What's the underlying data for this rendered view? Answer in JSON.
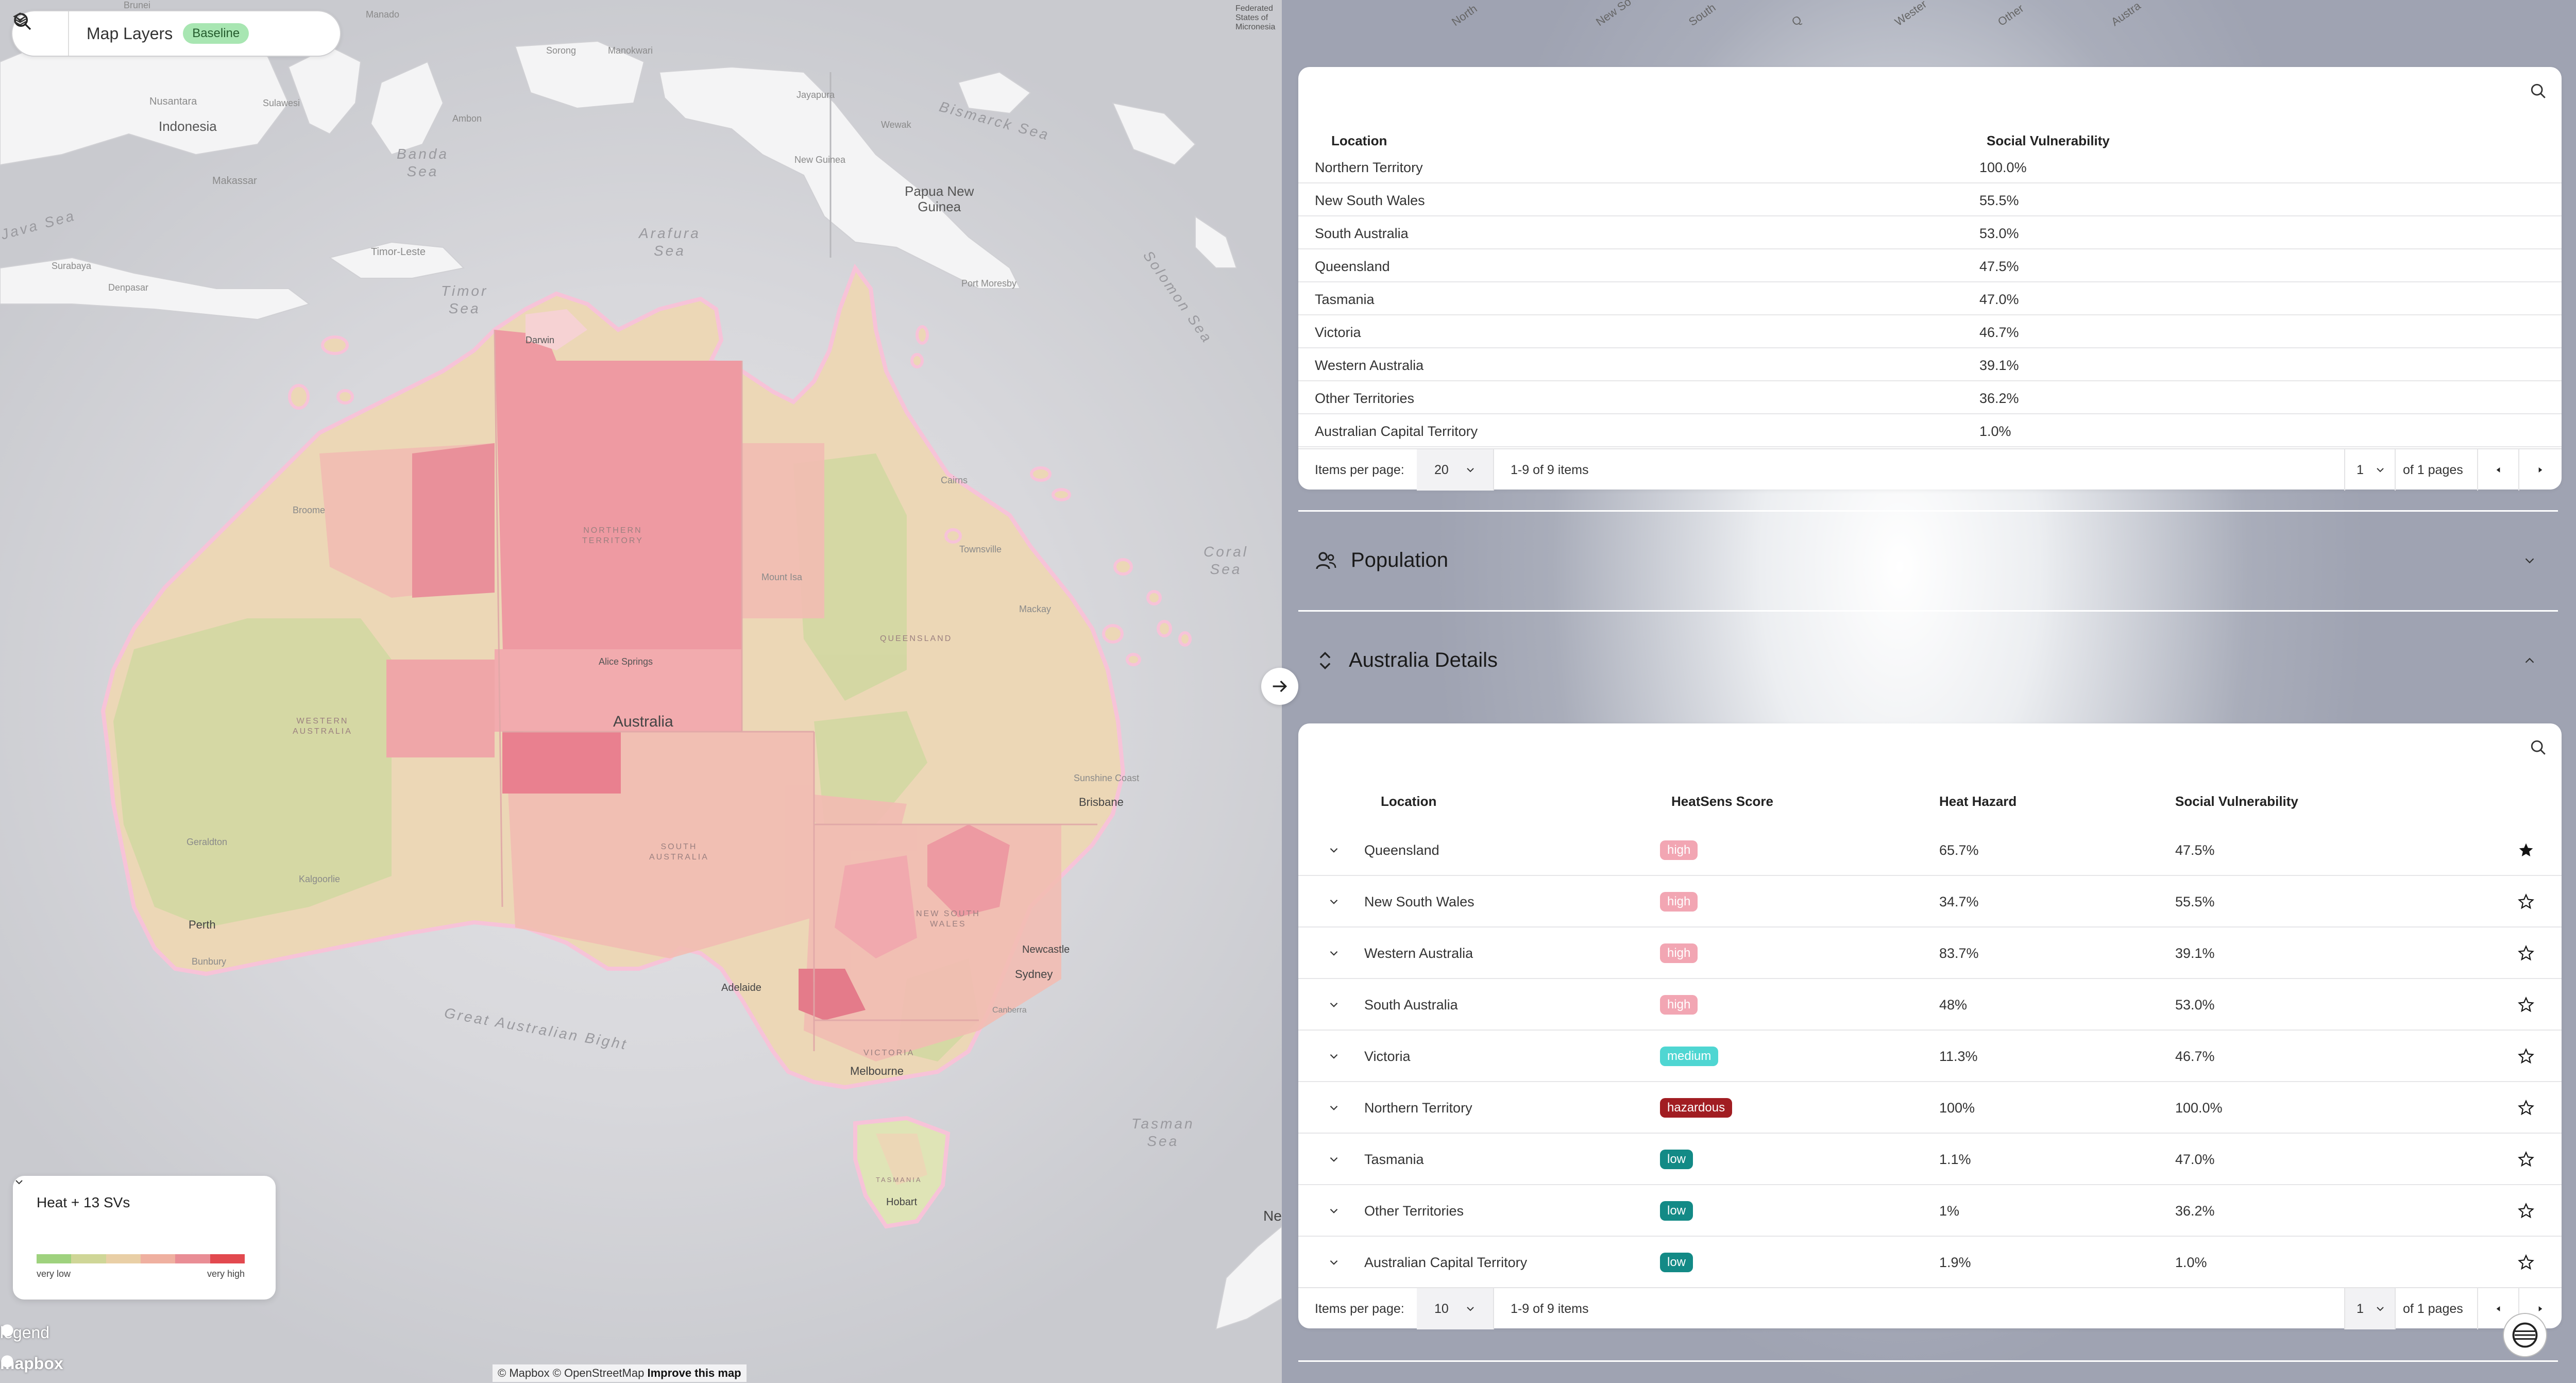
{
  "map": {
    "layers_label": "Map Layers",
    "scenario_badge": "Baseline",
    "legend": {
      "title": "Heat + 13 SVs",
      "low_label": "very low",
      "high_label": "very high",
      "colors": [
        "#9fd27e",
        "#cfd697",
        "#e9cfa6",
        "#efb0a0",
        "#e98d95",
        "#e2494f"
      ]
    },
    "legend_link": "legend",
    "logo": "mapbox",
    "attribution": "© Mapbox © OpenStreetMap",
    "attribution_link": "Improve this map",
    "labels": {
      "brunei": "Brunei",
      "manado": "Manado",
      "sorong": "Sorong",
      "manokwari": "Manokwari",
      "nusantara": "Nusantara",
      "sulawesi": "Sulawesi",
      "indonesia": "Indonesia",
      "ambon": "Ambon",
      "jayapura": "Jayapura",
      "wewak": "Wewak",
      "makassar": "Makassar",
      "banda_sea": "Banda\nSea",
      "bismarck_sea": "Bismarck Sea",
      "new_guinea": "New Guinea",
      "papua_new_guinea": "Papua New\nGuinea",
      "java_sea": "Java Sea",
      "timor_leste": "Timor-Leste",
      "arafura_sea": "Arafura\nSea",
      "surabaya": "Surabaya",
      "denpasar": "Denpasar",
      "timor_sea": "Timor\nSea",
      "port_moresby": "Port Moresby",
      "solomon_sea": "Solomon Sea",
      "darwin": "Darwin",
      "federated_states": "Federated\nStates of\nMicronesia",
      "northern_territory": "NORTHERN\nTERRITORY",
      "queensland": "QUEENSLAND",
      "western_australia": "WESTERN\nAUSTRALIA",
      "south_australia": "SOUTH\nAUSTRALIA",
      "new_south_wales": "NEW SOUTH\nWALES",
      "victoria": "VICTORIA",
      "tasmania": "TASMANIA",
      "broome": "Broome",
      "cairns": "Cairns",
      "townsville": "Townsville",
      "mount_isa": "Mount Isa",
      "mackay": "Mackay",
      "coral_sea": "Coral\nSea",
      "alice_springs": "Alice Springs",
      "australia": "Australia",
      "sunshine_coast": "Sunshine Coast",
      "brisbane": "Brisbane",
      "geraldton": "Geraldton",
      "kalgoorlie": "Kalgoorlie",
      "newcastle": "Newcastle",
      "perth": "Perth",
      "bunbury": "Bunbury",
      "sydney": "Sydney",
      "canberra": "Canberra",
      "adelaide": "Adelaide",
      "great_australian_bight": "Great Australian Bight",
      "melbourne": "Melbourne",
      "tasman_sea": "Tasman\nSea",
      "hobart": "Hobart",
      "new_zealand_partial": "Ne"
    }
  },
  "panel": {
    "top_rotated_labels": [
      "North",
      "New So",
      "South",
      "Q",
      "Wester",
      "Other",
      "Austra"
    ],
    "table1": {
      "headers": {
        "location": "Location",
        "social_vulnerability": "Social Vulnerability"
      },
      "rows": [
        {
          "location": "Northern Territory",
          "sv": "100.0%"
        },
        {
          "location": "New South Wales",
          "sv": "55.5%"
        },
        {
          "location": "South Australia",
          "sv": "53.0%"
        },
        {
          "location": "Queensland",
          "sv": "47.5%"
        },
        {
          "location": "Tasmania",
          "sv": "47.0%"
        },
        {
          "location": "Victoria",
          "sv": "46.7%"
        },
        {
          "location": "Western Australia",
          "sv": "39.1%"
        },
        {
          "location": "Other Territories",
          "sv": "36.2%"
        },
        {
          "location": "Australian Capital Territory",
          "sv": "1.0%"
        }
      ],
      "pager": {
        "items_per_page_label": "Items per page:",
        "items_per_page": "20",
        "range": "1-9 of 9 items",
        "page": "1",
        "of_pages": "of 1 pages"
      }
    },
    "section_population": "Population",
    "section_details": "Australia Details",
    "table2": {
      "headers": {
        "location": "Location",
        "heatsens": "HeatSens Score",
        "heat_hazard": "Heat Hazard",
        "social_vulnerability": "Social Vulnerability"
      },
      "rows": [
        {
          "location": "Queensland",
          "score": "high",
          "hazard": "65.7%",
          "sv": "47.5%",
          "starred": true
        },
        {
          "location": "New South Wales",
          "score": "high",
          "hazard": "34.7%",
          "sv": "55.5%",
          "starred": false
        },
        {
          "location": "Western Australia",
          "score": "high",
          "hazard": "83.7%",
          "sv": "39.1%",
          "starred": false
        },
        {
          "location": "South Australia",
          "score": "high",
          "hazard": "48%",
          "sv": "53.0%",
          "starred": false
        },
        {
          "location": "Victoria",
          "score": "medium",
          "hazard": "11.3%",
          "sv": "46.7%",
          "starred": false
        },
        {
          "location": "Northern Territory",
          "score": "hazardous",
          "hazard": "100%",
          "sv": "100.0%",
          "starred": false
        },
        {
          "location": "Tasmania",
          "score": "low",
          "hazard": "1.1%",
          "sv": "47.0%",
          "starred": false
        },
        {
          "location": "Other Territories",
          "score": "low",
          "hazard": "1%",
          "sv": "36.2%",
          "starred": false
        },
        {
          "location": "Australian Capital Territory",
          "score": "low",
          "hazard": "1.9%",
          "sv": "1.0%",
          "starred": false
        }
      ],
      "pager": {
        "items_per_page_label": "Items per page:",
        "items_per_page": "10",
        "range": "1-9 of 9 items",
        "page": "1",
        "of_pages": "of 1 pages"
      }
    }
  }
}
